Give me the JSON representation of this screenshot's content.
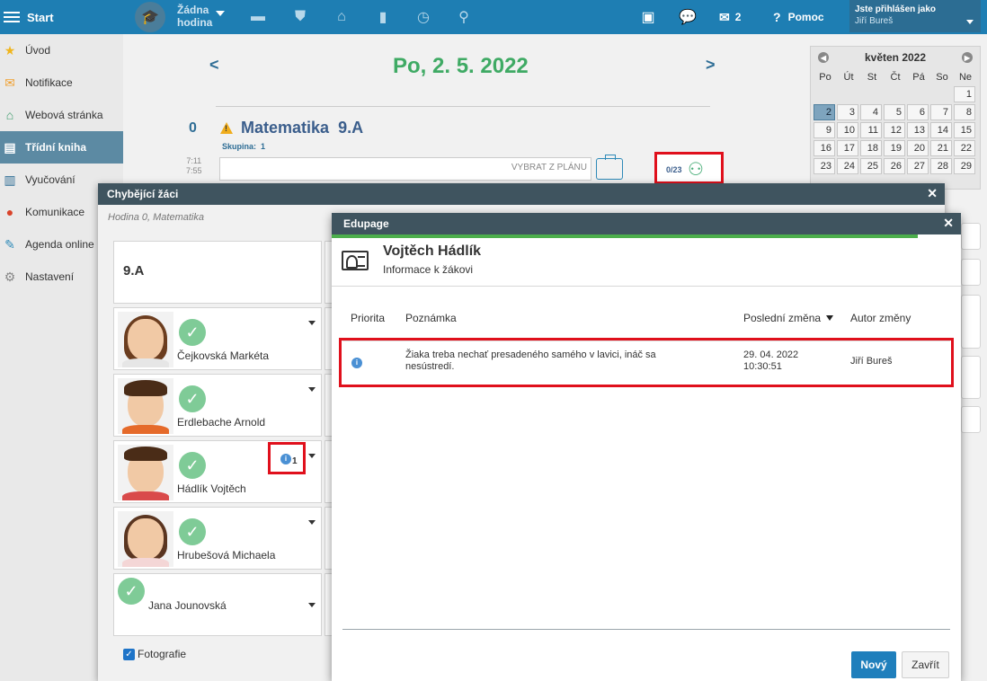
{
  "topbar": {
    "start_label": "Start",
    "no_lesson_line1": "Žádna",
    "no_lesson_line2": "hodina",
    "message_count": "2",
    "help_label": "Pomoc",
    "logged_in_label": "Jste přihlášen jako",
    "user_name": "Jiří Bureš",
    "icons": [
      "menu-icon",
      "graduation-cap-icon",
      "briefcase-icon",
      "shield-icon",
      "school-icon",
      "bar-chart-icon",
      "clock-icon",
      "people-walking-icon",
      "screen-share-icon",
      "chat-icon",
      "mail-icon",
      "help-icon"
    ]
  },
  "sidebar": {
    "items": [
      {
        "label": "Úvod",
        "icon": "star-icon"
      },
      {
        "label": "Notifikace",
        "icon": "envelope-icon"
      },
      {
        "label": "Webová stránka",
        "icon": "house-icon"
      },
      {
        "label": "Třídní kniha",
        "icon": "book-icon",
        "active": true
      },
      {
        "label": "Vyučování",
        "icon": "open-book-icon"
      },
      {
        "label": "Komunikace",
        "icon": "chat-icon"
      },
      {
        "label": "Agenda online",
        "icon": "pen-icon"
      },
      {
        "label": "Nastavení",
        "icon": "gear-icon"
      }
    ]
  },
  "main": {
    "date_title": "Po, 2. 5. 2022",
    "lesson_number": "0",
    "time_start": "7:11",
    "time_end": "7:55",
    "subject": "Matematika",
    "class_name": "9.A",
    "group_label": "Skupina:",
    "group_value": "1",
    "plan_button": "VYBRAT Z PLÁNU",
    "attendance": "0/23"
  },
  "calendar": {
    "month": "květen 2022",
    "weekdays": [
      "Po",
      "Út",
      "St",
      "Čt",
      "Pá",
      "So",
      "Ne"
    ],
    "weeks": [
      [
        "",
        "",
        "",
        "",
        "",
        "",
        "1"
      ],
      [
        "2",
        "3",
        "4",
        "5",
        "6",
        "7",
        "8"
      ],
      [
        "9",
        "10",
        "11",
        "12",
        "13",
        "14",
        "15"
      ],
      [
        "16",
        "17",
        "18",
        "19",
        "20",
        "21",
        "22"
      ],
      [
        "23",
        "24",
        "25",
        "26",
        "27",
        "28",
        "29"
      ]
    ],
    "selected": "2"
  },
  "missing_dialog": {
    "title": "Chybějící žáci",
    "subtitle": "Hodina 0, Matematika",
    "class_name": "9.A",
    "students": [
      {
        "name": "Čejkovská Markéta"
      },
      {
        "name": "Erdlebache Arnold"
      },
      {
        "name": "Hádlík Vojtěch",
        "note_count": "1"
      },
      {
        "name": "Hrubešová Michaela"
      },
      {
        "name": "Jana Jounovská"
      }
    ],
    "photos_label": "Fotografie"
  },
  "edupage_dialog": {
    "title": "Edupage",
    "student_name": "Vojtěch Hádlík",
    "student_sub": "Informace k žákovi",
    "columns": {
      "priority": "Priorita",
      "note": "Poznámka",
      "last_change": "Poslední změna",
      "author": "Autor změny"
    },
    "row": {
      "note": "Žiaka treba nechať presadeného samého v lavici, ináč sa nesústredí.",
      "date": "29. 04. 2022",
      "time": "10:30:51",
      "author": "Jiří Bureš"
    },
    "new_button": "Nový",
    "close_button": "Zavřít"
  },
  "colors": {
    "topbar": "#1e7eb3",
    "date_green": "#3faa64",
    "dialog_header": "#3f545f",
    "highlight_red": "#e0101c",
    "primary_button": "#1f7fbc"
  }
}
